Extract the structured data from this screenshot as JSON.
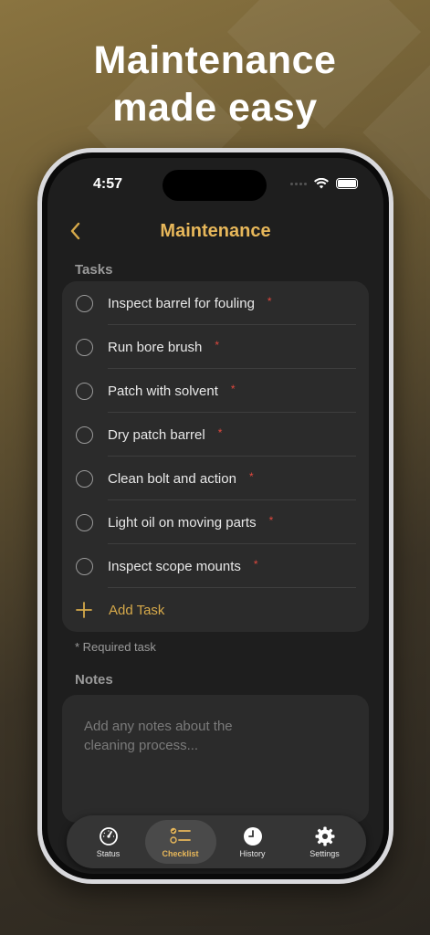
{
  "headline": {
    "line1": "Maintenance",
    "line2": "made easy"
  },
  "status_bar": {
    "time": "4:57"
  },
  "nav": {
    "back_icon": "chevron-left-icon",
    "title": "Maintenance"
  },
  "tasks_section": {
    "label": "Tasks",
    "items": [
      {
        "label": "Inspect barrel for fouling",
        "required": "*"
      },
      {
        "label": "Run bore brush",
        "required": "*"
      },
      {
        "label": "Patch with solvent",
        "required": "*"
      },
      {
        "label": "Dry patch barrel",
        "required": "*"
      },
      {
        "label": "Clean bolt and action",
        "required": "*"
      },
      {
        "label": "Light oil on moving parts",
        "required": "*"
      },
      {
        "label": "Inspect scope mounts",
        "required": "*"
      }
    ],
    "add_label": "Add Task",
    "required_note": "* Required task"
  },
  "notes_section": {
    "label": "Notes",
    "placeholder": "Add any notes about the cleaning process..."
  },
  "tabbar": {
    "tabs": [
      {
        "label": "Status",
        "icon": "gauge-icon",
        "active": false
      },
      {
        "label": "Checklist",
        "icon": "checklist-icon",
        "active": true
      },
      {
        "label": "History",
        "icon": "clock-icon",
        "active": false
      },
      {
        "label": "Settings",
        "icon": "gear-icon",
        "active": false
      }
    ]
  },
  "colors": {
    "accent": "#e7b75a",
    "required": "#e0483e",
    "card": "#2b2b2b",
    "screen": "#1e1e1e"
  }
}
